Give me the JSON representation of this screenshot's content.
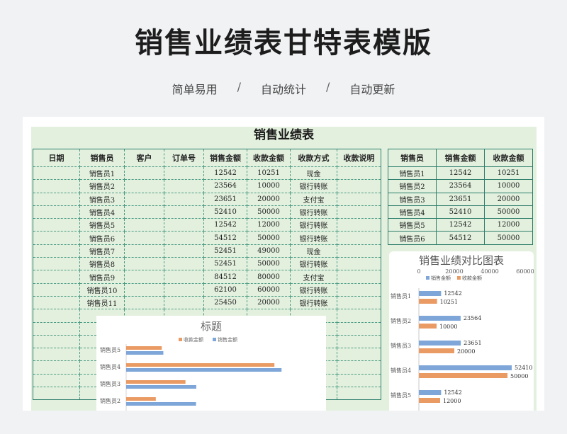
{
  "hero": {
    "title": "销售业绩表甘特表模版",
    "tags": [
      "简单易用",
      "自动统计",
      "自动更新"
    ],
    "separator": "/"
  },
  "sheet": {
    "title": "销售业绩表",
    "headers": [
      "日期",
      "销售员",
      "客户",
      "订单号",
      "销售金额",
      "收款金额",
      "收款方式",
      "收款说明"
    ],
    "rows": [
      {
        "seller": "销售员1",
        "sales": "12542",
        "received": "10251",
        "method": "现金"
      },
      {
        "seller": "销售员2",
        "sales": "23564",
        "received": "10000",
        "method": "银行转账"
      },
      {
        "seller": "销售员3",
        "sales": "23651",
        "received": "20000",
        "method": "支付宝"
      },
      {
        "seller": "销售员4",
        "sales": "52410",
        "received": "50000",
        "method": "银行转账"
      },
      {
        "seller": "销售员5",
        "sales": "12542",
        "received": "12000",
        "method": "银行转账"
      },
      {
        "seller": "销售员6",
        "sales": "54512",
        "received": "50000",
        "method": "银行转账"
      },
      {
        "seller": "销售员7",
        "sales": "52451",
        "received": "49000",
        "method": "现金"
      },
      {
        "seller": "销售员8",
        "sales": "52451",
        "received": "50000",
        "method": "银行转账"
      },
      {
        "seller": "销售员9",
        "sales": "84512",
        "received": "80000",
        "method": "支付宝"
      },
      {
        "seller": "销售员10",
        "sales": "62100",
        "received": "60000",
        "method": "银行转账"
      },
      {
        "seller": "销售员11",
        "sales": "25450",
        "received": "20000",
        "method": "银行转账"
      }
    ],
    "empty_rows": 7
  },
  "summary": {
    "headers": [
      "销售员",
      "销售金额",
      "收款金额"
    ],
    "rows": [
      [
        "销售员1",
        "12542",
        "10251"
      ],
      [
        "销售员2",
        "23564",
        "10000"
      ],
      [
        "销售员3",
        "23651",
        "20000"
      ],
      [
        "销售员4",
        "52410",
        "50000"
      ],
      [
        "销售员5",
        "12542",
        "12000"
      ],
      [
        "销售员6",
        "54512",
        "50000"
      ]
    ]
  },
  "colors": {
    "blue": "#7ea6d8",
    "orange": "#ea9a63",
    "grid": "#4a9c84",
    "bg": "#e3f0de"
  },
  "chart_data": [
    {
      "type": "bar",
      "title": "销售业绩对比图表",
      "categories": [
        "销售员1",
        "销售员2",
        "销售员3",
        "销售员4",
        "销售员5"
      ],
      "series": [
        {
          "name": "销售金额",
          "values": [
            12542,
            23564,
            23651,
            52410,
            12542
          ]
        },
        {
          "name": "收款金额",
          "values": [
            10251,
            10000,
            20000,
            50000,
            12000
          ]
        }
      ],
      "xticks": [
        "0",
        "20000",
        "40000",
        "60000"
      ],
      "xlim": [
        0,
        60000
      ],
      "legend": "top"
    },
    {
      "type": "bar",
      "title": "标题",
      "categories": [
        "销售员5",
        "销售员4",
        "销售员3",
        "销售员2"
      ],
      "series": [
        {
          "name": "收款金额",
          "values": [
            12000,
            50000,
            20000,
            10000
          ]
        },
        {
          "name": "销售金额",
          "values": [
            12542,
            52410,
            23651,
            23564
          ]
        }
      ],
      "xlim": [
        0,
        60000
      ],
      "legend": "top"
    }
  ]
}
